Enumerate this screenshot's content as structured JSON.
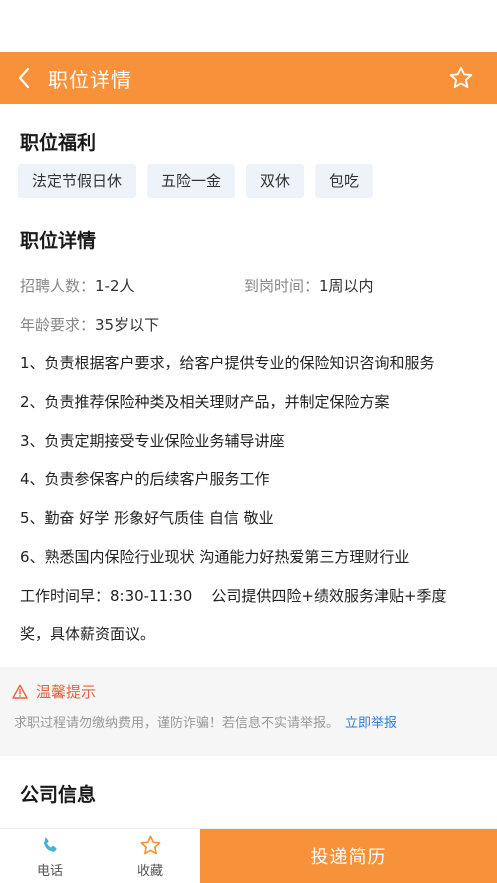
{
  "header": {
    "title": "职位详情"
  },
  "benefits": {
    "title": "职位福利",
    "tags": [
      "法定节假日休",
      "五险一金",
      "双休",
      "包吃"
    ]
  },
  "details": {
    "title": "职位详情",
    "recruit_label": "招聘人数：",
    "recruit_value": "1-2人",
    "arrival_label": "到岗时间：",
    "arrival_value": "1周以内",
    "age_label": "年龄要求：",
    "age_value": "35岁以下",
    "duties": [
      "1、负责根据客户要求，给客户提供专业的保险知识咨询和服务",
      "2、负责推荐保险种类及相关理财产品，并制定保险方案",
      "3、负责定期接受专业保险业务辅导讲座",
      "4、负责参保客户的后续客户服务工作",
      "5、勤奋 好学 形象好气质佳 自信 敬业",
      "6、熟悉国内保险行业现状 沟通能力好热爱第三方理财行业",
      "工作时间早：8:30-11:30    公司提供四险+绩效服务津贴+季度",
      "奖，具体薪资面议。"
    ]
  },
  "warning": {
    "title": "温馨提示",
    "text": "求职过程请勿缴纳费用，谨防诈骗！若信息不实请举报。",
    "link": "立即举报"
  },
  "company": {
    "title": "公司信息"
  },
  "bottom": {
    "phone_label": "电话",
    "favorite_label": "收藏",
    "apply_label": "投递简历"
  },
  "colors": {
    "accent": "#f7923a",
    "tag_bg": "#edf3f9",
    "warning": "#e8603a",
    "link": "#2f7bd4"
  }
}
